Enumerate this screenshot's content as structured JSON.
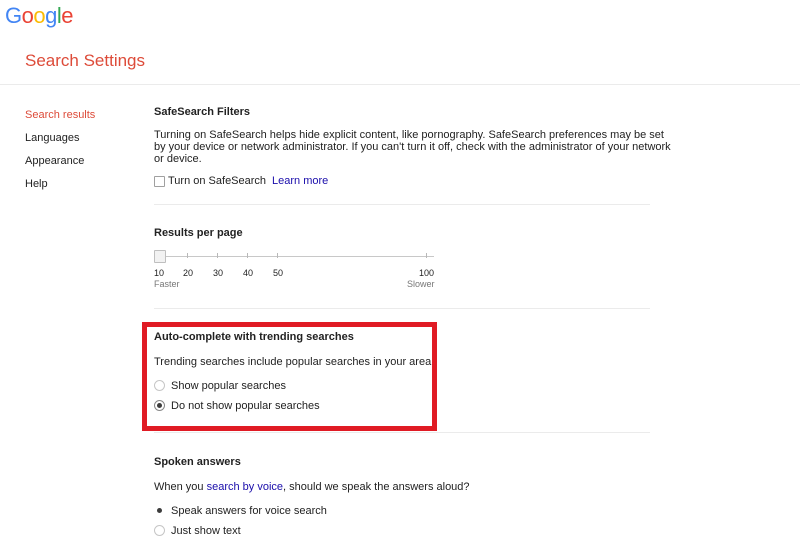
{
  "logo": {
    "letters": [
      {
        "ch": "G",
        "color": "#4285f4"
      },
      {
        "ch": "o",
        "color": "#ea4335"
      },
      {
        "ch": "o",
        "color": "#fbbc05"
      },
      {
        "ch": "g",
        "color": "#4285f4"
      },
      {
        "ch": "l",
        "color": "#34a853"
      },
      {
        "ch": "e",
        "color": "#ea4335"
      }
    ]
  },
  "page_title": "Search Settings",
  "sidebar": {
    "items": [
      {
        "label": "Search results",
        "active": true
      },
      {
        "label": "Languages"
      },
      {
        "label": "Appearance"
      },
      {
        "label": "Help"
      }
    ]
  },
  "safesearch": {
    "title": "SafeSearch Filters",
    "description_lines": [
      "Turning on SafeSearch helps hide explicit content, like pornography. SafeSearch preferences may be set",
      "by your device or network administrator. If you can't turn it off, check with the administrator of your network",
      "or device."
    ],
    "checkbox_label": "Turn on SafeSearch",
    "checked": false,
    "learn_more": "Learn more"
  },
  "results_per_page": {
    "title": "Results per page",
    "ticks": [
      "10",
      "20",
      "30",
      "40",
      "50",
      "100"
    ],
    "selected": 10,
    "min_label": "Faster",
    "max_label": "Slower"
  },
  "autocomplete": {
    "title": "Auto-complete with trending searches",
    "description": "Trending searches include popular searches in your area.",
    "options": [
      {
        "label": "Show popular searches",
        "checked": false
      },
      {
        "label": "Do not show popular searches",
        "checked": true
      }
    ]
  },
  "spoken_answers": {
    "title": "Spoken answers",
    "question_prefix": "When you ",
    "question_link": "search by voice",
    "question_suffix": ", should we speak the answers aloud?",
    "options": [
      {
        "label": "Speak answers for voice search",
        "checked": true
      },
      {
        "label": "Just show text",
        "checked": false
      }
    ]
  },
  "colors": {
    "accent_red": "#dd4b39",
    "link_blue": "#1a0dab",
    "highlight": "#e01b24"
  }
}
